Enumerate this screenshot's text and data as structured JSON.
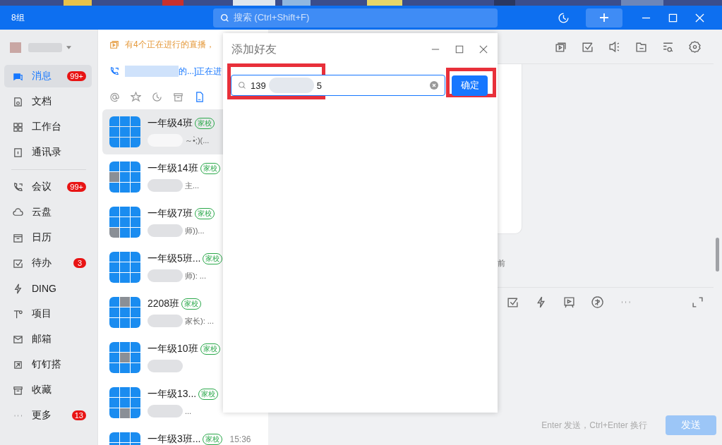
{
  "window": {
    "logo": "8组",
    "search_placeholder": "搜索 (Ctrl+Shift+F)"
  },
  "sidebar": {
    "groups": [
      [
        {
          "label": "消息",
          "badge": "99+",
          "selected": true
        },
        {
          "label": "文档",
          "selected": false
        },
        {
          "label": "工作台",
          "selected": false
        },
        {
          "label": "通讯录",
          "selected": false
        }
      ],
      [
        {
          "label": "会议",
          "badge": "99+",
          "selected": false
        },
        {
          "label": "云盘",
          "selected": false
        },
        {
          "label": "日历",
          "selected": false
        },
        {
          "label": "待办",
          "badge": "3",
          "selected": false
        },
        {
          "label": "DING",
          "selected": false
        },
        {
          "label": "项目",
          "selected": false
        },
        {
          "label": "邮箱",
          "selected": false
        },
        {
          "label": "钉钉搭",
          "selected": false
        },
        {
          "label": "收藏",
          "selected": false
        },
        {
          "label": "更多",
          "badge": "13",
          "selected": false
        }
      ]
    ]
  },
  "conversations": {
    "notices": [
      {
        "kind": "live",
        "text": "有4个正在进行的直播，"
      },
      {
        "kind": "call",
        "text": "的...]正在进"
      }
    ],
    "filters": [
      {
        "selected": false
      },
      {
        "selected": false
      },
      {
        "selected": false
      },
      {
        "selected": false
      },
      {
        "selected": true
      }
    ],
    "items": [
      {
        "name": "一年级4班",
        "tag": "家校",
        "preview": "～•̀;)(...",
        "selected": true
      },
      {
        "name": "一年级14班",
        "tag": "家校",
        "preview": "主...",
        "selected": false
      },
      {
        "name": "一年级7班",
        "tag": "家校",
        "preview": "师))...",
        "selected": false
      },
      {
        "name": "一年级5班...",
        "tag": "家校",
        "preview": "师): ...",
        "selected": false
      },
      {
        "name": "2208班",
        "tag": "家校",
        "preview": "家长): ...",
        "selected": false
      },
      {
        "name": "一年级10班",
        "tag": "家校",
        "selected": false
      },
      {
        "name": "一年级13...",
        "tag": "家校",
        "preview": "...",
        "selected": false
      },
      {
        "name": "一年级3班...",
        "tag": "家校",
        "time": "15:36",
        "selected": false
      }
    ]
  },
  "dialog": {
    "title": "添加好友",
    "value_start": "139",
    "value_end": "5",
    "button": "确定",
    "highlight_field": true,
    "highlight_button": true
  },
  "chat": {
    "message_fragment": "前",
    "hint": "Enter 发送，Ctrl+Enter 换行",
    "send": "发送",
    "send_disabled": true
  }
}
